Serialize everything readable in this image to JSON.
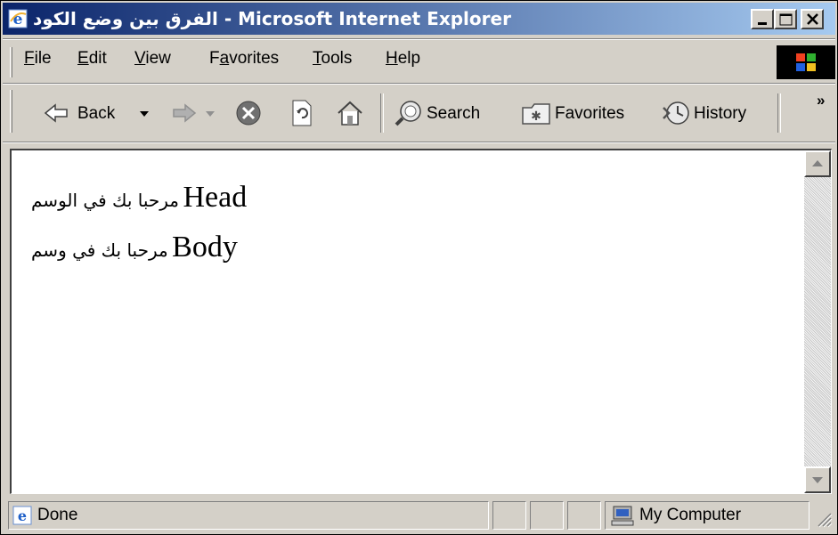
{
  "window": {
    "title": "الفرق بين وضع الكود - Microsoft Internet Explorer",
    "icons": {
      "app": "ie-logo-icon",
      "minimize": "minimize-icon",
      "maximize": "maximize-icon",
      "close": "close-icon"
    }
  },
  "menu": {
    "file": "File",
    "edit": "Edit",
    "view": "View",
    "favorites": "Favorites",
    "tools": "Tools",
    "help": "Help"
  },
  "toolbar": {
    "back": "Back",
    "search": "Search",
    "favorites": "Favorites",
    "history": "History",
    "more": "»"
  },
  "content": {
    "line1": {
      "en": "Head",
      "ar": "مرحبا بك في الوسم"
    },
    "line2": {
      "en": "Body",
      "ar": "مرحبا بك في وسم"
    }
  },
  "status": {
    "text": "Done",
    "zone": "My Computer"
  },
  "colors": {
    "title_start": "#0a246a",
    "title_end": "#a6caf0",
    "chrome": "#d4d0c8"
  }
}
